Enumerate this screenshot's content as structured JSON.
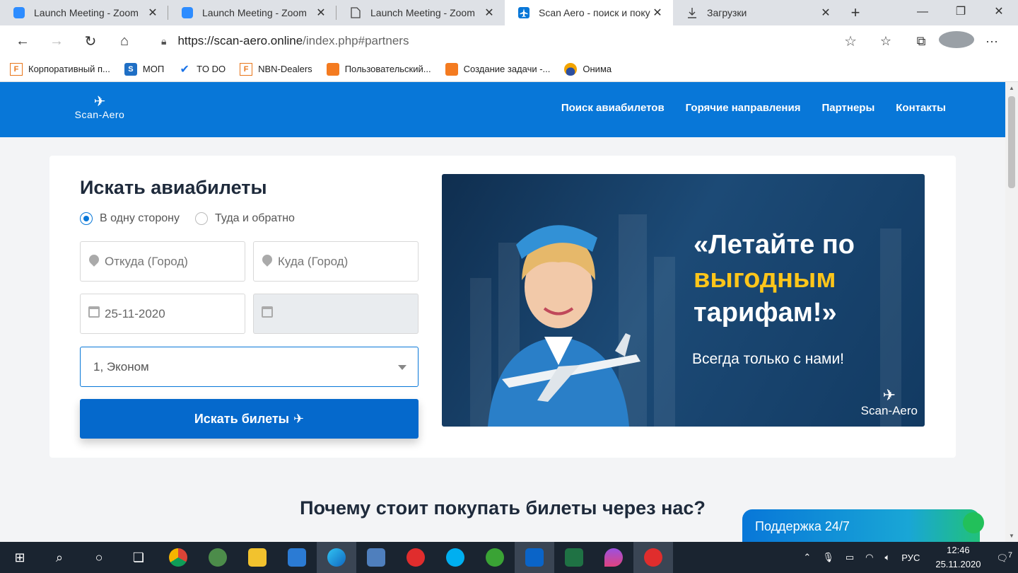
{
  "browser": {
    "tabs": [
      {
        "title": "Launch Meeting - Zoom",
        "icon": "zoom-icon"
      },
      {
        "title": "Launch Meeting - Zoom",
        "icon": "zoom-icon"
      },
      {
        "title": "Launch Meeting - Zoom",
        "icon": "page-icon"
      },
      {
        "title": "Scan Aero - поиск и покуп",
        "icon": "plane-icon"
      },
      {
        "title": "Загрузки",
        "icon": "download-icon"
      }
    ],
    "url_host": "https://scan-aero.online",
    "url_path": "/index.php#partners",
    "bookmarks": [
      {
        "label": "Корпоративный п..."
      },
      {
        "label": "МОП"
      },
      {
        "label": "TO DO"
      },
      {
        "label": "NBN-Dealers"
      },
      {
        "label": "Пользовательский..."
      },
      {
        "label": "Создание задачи -..."
      },
      {
        "label": "Онима"
      }
    ]
  },
  "site": {
    "logo_text": "Scan-Aero",
    "nav": [
      "Поиск авиабилетов",
      "Горячие направления",
      "Партнеры",
      "Контакты"
    ]
  },
  "search": {
    "title": "Искать авиабилеты",
    "trip_types": [
      "В одну сторону",
      "Туда и обратно"
    ],
    "selected_trip": "В одну сторону",
    "from_placeholder": "Откуда (Город)",
    "to_placeholder": "Куда (Город)",
    "depart_date": "25-11-2020",
    "return_date": "",
    "passengers": "1, Эконом",
    "button": "Искать билеты"
  },
  "banner": {
    "line1": "«Летайте по",
    "line2": "выгодным",
    "line3": "тарифам!»",
    "sub": "Всегда только с нами!",
    "logo": "Scan-Aero"
  },
  "why_title": "Почему стоит покупать билеты через нас?",
  "support_label": "Поддержка 24/7",
  "taskbar": {
    "lang": "РУС",
    "time": "12:46",
    "date": "25.11.2020",
    "notifications": "7"
  }
}
